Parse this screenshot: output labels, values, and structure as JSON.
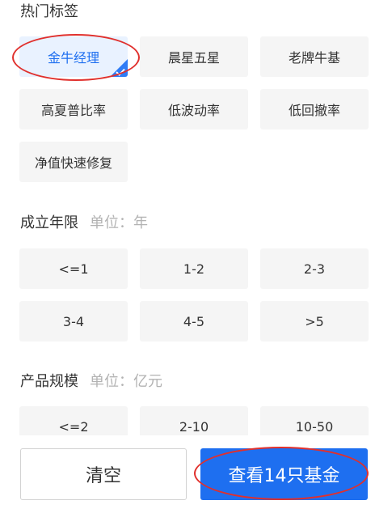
{
  "hot_tags": {
    "title": "热门标签",
    "items": [
      {
        "label": "金牛经理",
        "selected": true
      },
      {
        "label": "晨星五星",
        "selected": false
      },
      {
        "label": "老牌牛基",
        "selected": false
      },
      {
        "label": "高夏普比率",
        "selected": false
      },
      {
        "label": "低波动率",
        "selected": false
      },
      {
        "label": "低回撤率",
        "selected": false
      },
      {
        "label": "净值快速修复",
        "selected": false
      }
    ]
  },
  "years": {
    "title": "成立年限",
    "unit": "单位：年",
    "items": [
      "<=1",
      "1-2",
      "2-3",
      "3-4",
      "4-5",
      ">5"
    ]
  },
  "scale": {
    "title": "产品规模",
    "unit": "单位：亿元",
    "items": [
      "<=2",
      "2-10",
      "10-50"
    ]
  },
  "actions": {
    "clear_label": "清空",
    "view_label": "查看14只基金"
  },
  "colors": {
    "accent": "#1e6ff0",
    "selected_bg": "#e9f2ff",
    "chip_bg": "#f5f5f5",
    "annotation": "#e0302d"
  },
  "icons": {
    "selected_marker": "check-icon"
  }
}
